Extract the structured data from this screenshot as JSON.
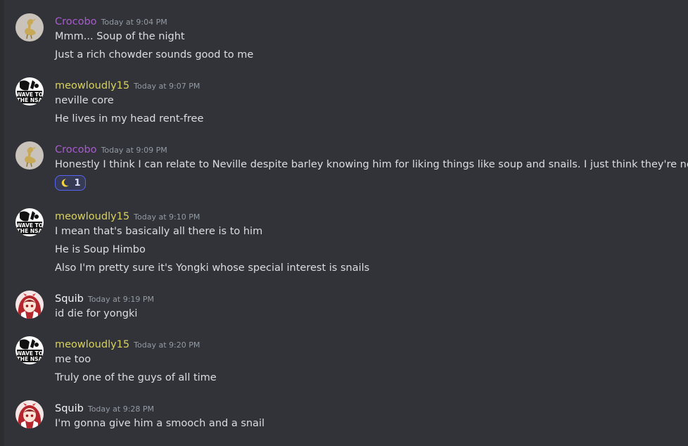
{
  "colors": {
    "crocobo_name": "#a95bcf",
    "meow_name": "#d8d25e",
    "squib_name": "#f2f3f5",
    "message_text": "#dbdee1",
    "timestamp": "#949ba4",
    "background": "#313338"
  },
  "messages": [
    {
      "username": "Crocobo",
      "timestamp": "Today at 9:04 PM",
      "avatar": "chocobo-avatar",
      "lines": [
        "Mmm... Soup of the night",
        "Just a rich chowder sounds good to me"
      ]
    },
    {
      "username": "meowloudly15",
      "timestamp": "Today at 9:07 PM",
      "avatar": "wave-to-the-nsa-avatar",
      "avatar_text": [
        "WAVE TO",
        "THE NSA"
      ],
      "lines": [
        "neville core",
        "He lives in my head rent-free"
      ]
    },
    {
      "username": "Crocobo",
      "timestamp": "Today at 9:09 PM",
      "avatar": "chocobo-avatar",
      "lines": [
        "Honestly I think I can relate to Neville despite barley knowing him for liking things like soup and snails. I just think they're neat"
      ],
      "reaction": {
        "icon": "crescent-moon-icon",
        "count": "1"
      }
    },
    {
      "username": "meowloudly15",
      "timestamp": "Today at 9:10 PM",
      "avatar": "wave-to-the-nsa-avatar",
      "avatar_text": [
        "WAVE TO",
        "THE NSA"
      ],
      "lines": [
        "I mean that's basically all there is to him",
        "He is Soup Himbo",
        "Also I'm pretty sure it's Yongki whose special interest is snails"
      ]
    },
    {
      "username": "Squib",
      "timestamp": "Today at 9:19 PM",
      "avatar": "squib-avatar",
      "lines": [
        "id die for yongki"
      ]
    },
    {
      "username": "meowloudly15",
      "timestamp": "Today at 9:20 PM",
      "avatar": "wave-to-the-nsa-avatar",
      "avatar_text": [
        "WAVE TO",
        "THE NSA"
      ],
      "lines": [
        "me too",
        "Truly one of the guys of all time"
      ]
    },
    {
      "username": "Squib",
      "timestamp": "Today at 9:28 PM",
      "avatar": "squib-avatar",
      "lines": [
        "I'm gonna give him a smooch and a snail"
      ]
    }
  ]
}
